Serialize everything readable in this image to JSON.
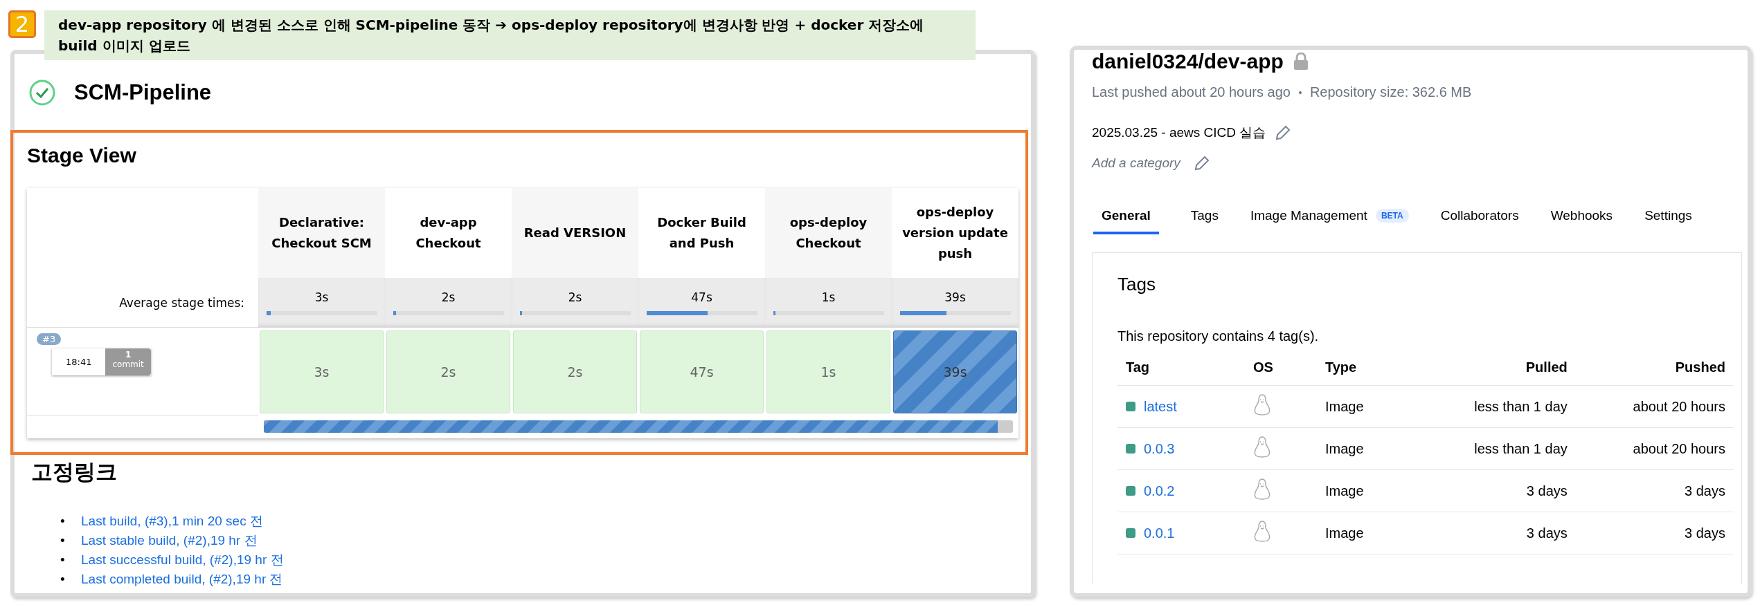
{
  "annotation": {
    "number": "2",
    "text": "dev-app repository 에 변경된 소스로 인해 SCM-pipeline 동작 ➔ ops-deploy repository에 변경사항 반영 + docker 저장소에 build 이미지 업로드"
  },
  "pipeline": {
    "title": "SCM-Pipeline",
    "stage_view": {
      "title": "Stage View",
      "average_label": "Average stage times:",
      "stages": [
        {
          "name": "Declarative: Checkout SCM",
          "average": "3s",
          "level": 0.04,
          "result": "3s",
          "kind": "success"
        },
        {
          "name": "dev-app Checkout",
          "average": "2s",
          "level": 0.03,
          "result": "2s",
          "kind": "success"
        },
        {
          "name": "Read VERSION",
          "average": "2s",
          "level": 0.02,
          "result": "2s",
          "kind": "success"
        },
        {
          "name": "Docker Build and Push",
          "average": "47s",
          "level": 0.55,
          "result": "47s",
          "kind": "success"
        },
        {
          "name": "ops-deploy Checkout",
          "average": "1s",
          "level": 0.02,
          "result": "1s",
          "kind": "success"
        },
        {
          "name": "ops-deploy version update push",
          "average": "39s",
          "level": 0.42,
          "result": "39s",
          "kind": "running"
        }
      ],
      "build": {
        "number": "#3",
        "time": "18:41",
        "commits": "1",
        "commits_label": "commit",
        "level": 0.98
      }
    },
    "permalinks": {
      "title": "고정링크",
      "links": [
        {
          "bullet": "•",
          "text": "Last build, (#3),1 min 20 sec 전"
        },
        {
          "bullet": "•",
          "text": "Last stable build, (#2),19 hr 전"
        },
        {
          "bullet": "•",
          "text": "Last successful build, (#2),19 hr 전"
        },
        {
          "bullet": "•",
          "text": "Last completed build, (#2),19 hr 전"
        }
      ]
    }
  },
  "repository": {
    "name": "daniel0324/dev-app",
    "private": true,
    "last_pushed": "Last pushed about 20 hours ago",
    "size": "Repository size: 362.6 MB",
    "description": "2025.03.25 - aews CICD 실습",
    "category_placeholder": "Add a category",
    "tabs": [
      {
        "label": "General",
        "selected": true
      },
      {
        "label": "Tags",
        "selected": false
      },
      {
        "label": "Image Management",
        "badge": "BETA",
        "selected": false
      },
      {
        "label": "Collaborators",
        "selected": false
      },
      {
        "label": "Webhooks",
        "selected": false
      },
      {
        "label": "Settings",
        "selected": false
      }
    ],
    "tags": {
      "title": "Tags",
      "summary": "This repository contains 4 tag(s).",
      "columns": [
        "Tag",
        "OS",
        "Type",
        "Pulled",
        "Pushed"
      ],
      "rows": [
        {
          "tag": "latest",
          "type": "Image",
          "pulled": "less than 1 day",
          "pushed": "about 20 hours"
        },
        {
          "tag": "0.0.3",
          "type": "Image",
          "pulled": "less than 1 day",
          "pushed": "about 20 hours"
        },
        {
          "tag": "0.0.2",
          "type": "Image",
          "pulled": "3 days",
          "pushed": "3 days"
        },
        {
          "tag": "0.0.1",
          "type": "Image",
          "pulled": "3 days",
          "pushed": "3 days"
        }
      ]
    }
  }
}
